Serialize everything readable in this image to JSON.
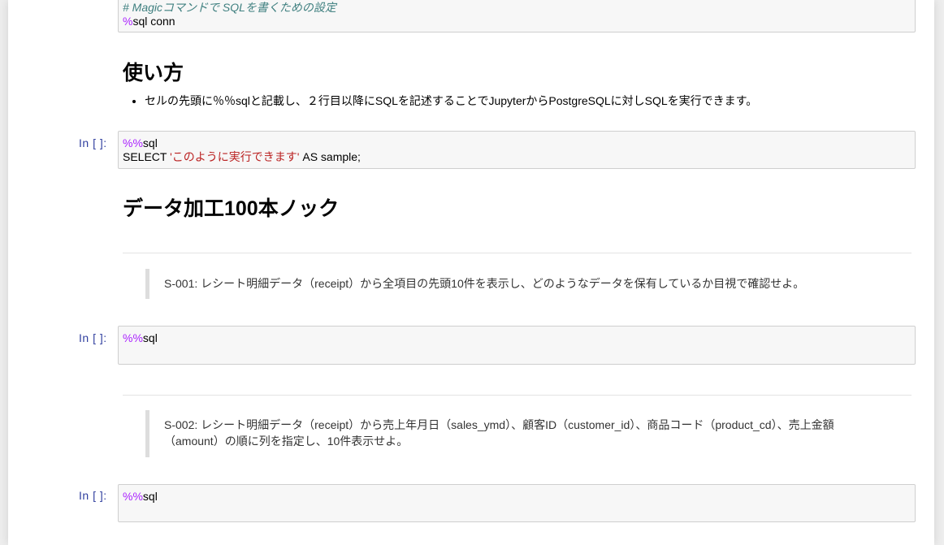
{
  "cells": {
    "setup_cell": {
      "comment": "# Magicコマンドで SQLを書くための設定",
      "magic": "%",
      "code": "sql conn"
    },
    "usage_heading": "使い方",
    "usage_bullet": "セルの先頭に％％sqlと記載し、２行目以降にSQLを記述することでJupyterからPostgreSQLに対しSQLを実行できます。",
    "example_cell": {
      "prompt": "In [ ]:",
      "magic": "%%",
      "line1": "sql",
      "select_kw": "SELECT ",
      "string": "'このように実行できます'",
      "rest": " AS sample;"
    },
    "knock_heading": "データ加工100本ノック",
    "s001": {
      "question": "S-001: レシート明細データ（receipt）から全項目の先頭10件を表示し、どのようなデータを保有しているか目視で確認せよ。",
      "prompt": "In [ ]:",
      "magic": "%%",
      "code": "sql"
    },
    "s002": {
      "question_line1": "S-002: レシート明細データ（receipt）から売上年月日（sales_ymd）、顧客ID（customer_id）、商品コード（product_cd）、売上金額",
      "question_line2": "（amount）の順に列を指定し、10件表示せよ。",
      "prompt": "In [ ]:",
      "magic": "%%",
      "code": "sql"
    }
  }
}
